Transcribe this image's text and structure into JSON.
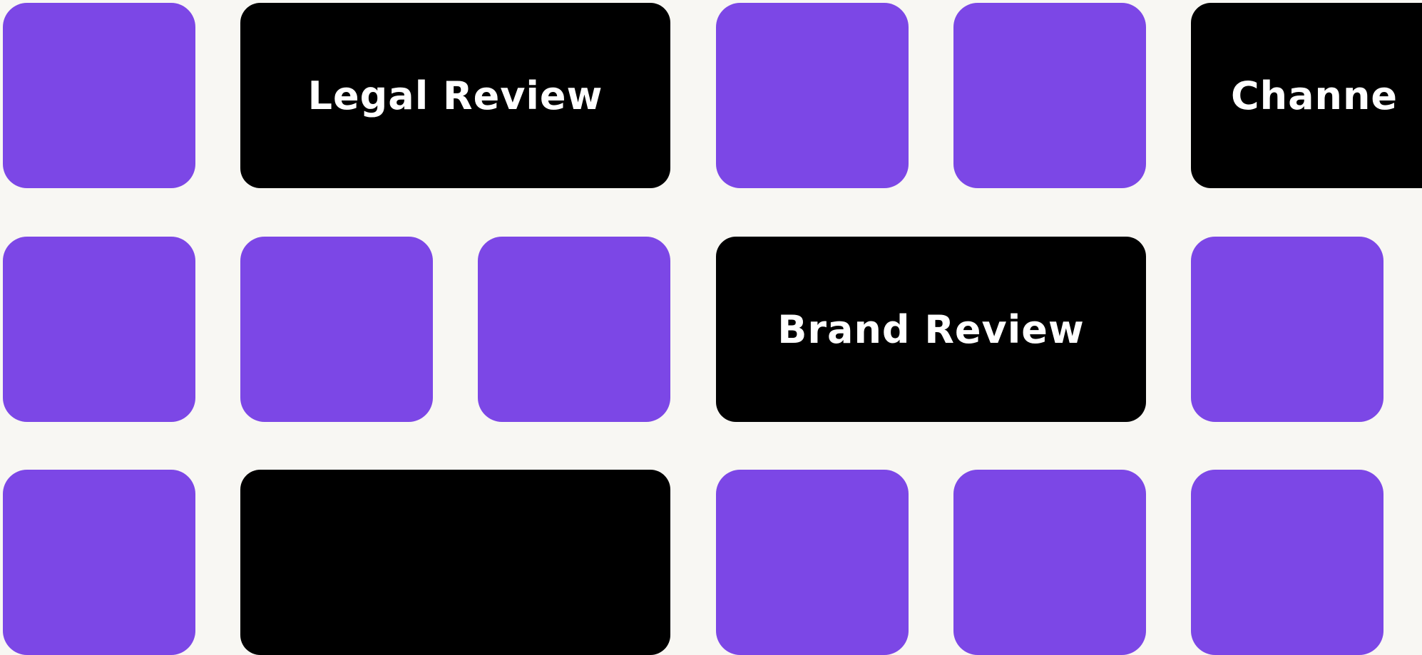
{
  "colors": {
    "background": "#f8f7f3",
    "accent": "#7c47e6",
    "dark": "#000000",
    "label_text": "#ffffff"
  },
  "tiles": {
    "legal_review": {
      "label": "Legal Review"
    },
    "channel": {
      "label": "Channe"
    },
    "brand_review": {
      "label": "Brand Review"
    },
    "bottom_wide": {
      "label": ""
    }
  }
}
